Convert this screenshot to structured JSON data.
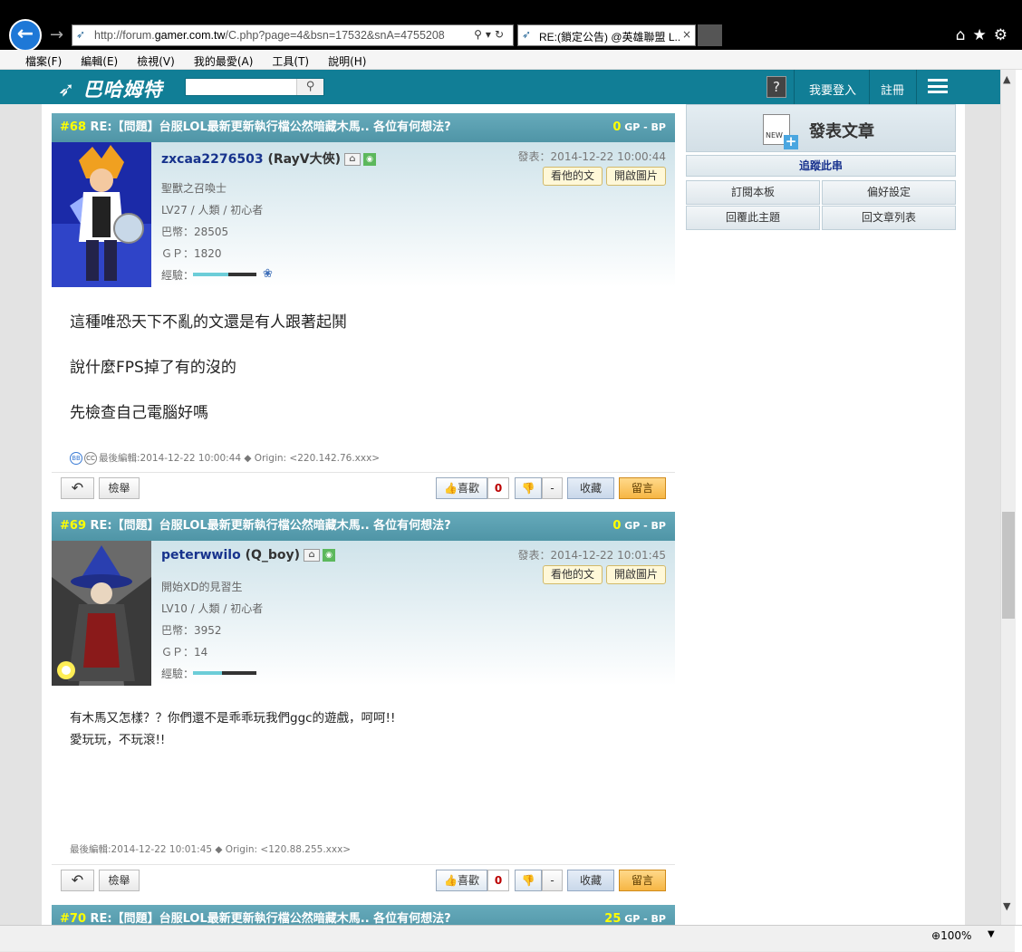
{
  "browser": {
    "back_icon": "arrow-left-icon",
    "url_prefix": "http://forum.",
    "url_domain": "gamer.com.tw",
    "url_rest": "/C.php?page=4&bsn=17532&snA=4755208",
    "tab_title": "RE:(鎖定公告) @英雄聯盟 L...",
    "tab_close": "×"
  },
  "menu": [
    "檔案(F)",
    "編輯(E)",
    "檢視(V)",
    "我的最愛(A)",
    "工具(T)",
    "說明(H)"
  ],
  "site": {
    "logo": "巴哈姆特",
    "login": "我要登入",
    "register": "註冊"
  },
  "sidebar": {
    "publish": "發表文章",
    "publish_badge": "NEW",
    "track": "追蹤此串",
    "buttons": [
      "訂閱本板",
      "偏好設定",
      "回覆此主題",
      "回文章列表"
    ]
  },
  "posts": [
    {
      "floor": "#68",
      "title": "RE:【問題】台服LOL最新更新執行檔公然暗藏木馬.. 各位有何想法?",
      "gp": "0",
      "gp_label": "GP",
      "bp": "- BP",
      "username": "zxcaa2276503",
      "nickname": "(RayV大俠)",
      "title_rank": "聖獸之召喚士",
      "level": "LV27 / 人類 / 初心者",
      "coins": "巴幣：28505",
      "gp_stat": "ＧＰ：1820",
      "exp_label": "經驗：",
      "exp_fraction": 0.55,
      "date": "發表：2014-12-22 10:00:44",
      "btn_view": "看他的文",
      "btn_images": "開啟圖片",
      "message": [
        "這種唯恐天下不亂的文還是有人跟著起鬨",
        "說什麼FPS掉了有的沒的",
        "先檢查自己電腦好嗎"
      ],
      "edited": "最後編輯:2014-12-22 10:00:44 ◆ Origin: <220.142.76.xxx>",
      "report": "檢舉",
      "like": "喜歡",
      "like_count": "0",
      "dislike_count": "-",
      "fav": "收藏",
      "reply": "留言"
    },
    {
      "floor": "#69",
      "title": "RE:【問題】台服LOL最新更新執行檔公然暗藏木馬.. 各位有何想法?",
      "gp": "0",
      "gp_label": "GP",
      "bp": "- BP",
      "username": "peterwwilo",
      "nickname": "(Q_boy)",
      "title_rank": "開始XD的見習生",
      "level": "LV10 / 人類 / 初心者",
      "coins": "巴幣：3952",
      "gp_stat": "ＧＰ：14",
      "exp_label": "經驗：",
      "exp_fraction": 0.45,
      "date": "發表：2014-12-22 10:01:45",
      "btn_view": "看他的文",
      "btn_images": "開啟圖片",
      "message": [
        "有木馬又怎樣？？你們還不是乖乖玩我們ggc的遊戲，呵呵!!",
        "愛玩玩，不玩滾!!"
      ],
      "edited": "最後編輯:2014-12-22 10:01:45 ◆ Origin: <120.88.255.xxx>",
      "report": "檢舉",
      "like": "喜歡",
      "like_count": "0",
      "dislike_count": "-",
      "fav": "收藏",
      "reply": "留言"
    },
    {
      "floor": "#70",
      "title": "RE:【問題】台服LOL最新更新執行檔公然暗藏木馬.. 各位有何想法?",
      "gp": "25",
      "gp_label": "GP",
      "bp": "- BP"
    }
  ],
  "status": {
    "zoom": "100%"
  },
  "colors": {
    "site_bar": "#117e96",
    "post_header": "#5a9fae",
    "username": "#17338d"
  }
}
